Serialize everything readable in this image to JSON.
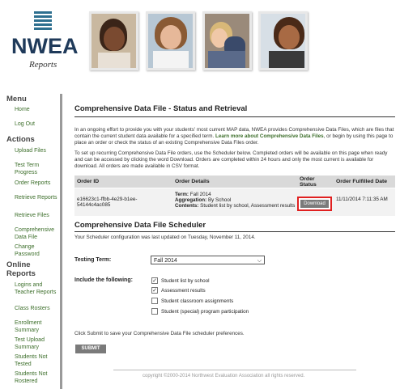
{
  "brand": {
    "name": "NWEA",
    "sub": "Reports"
  },
  "sidebar": {
    "menu_heading": "Menu",
    "menu_items": [
      "Home",
      "Log Out"
    ],
    "actions_heading": "Actions",
    "actions_items": [
      "Upload Files",
      "Test Term Progress",
      "Order Reports",
      "Retrieve Reports",
      "Retrieve Files",
      "Comprehensive Data File",
      "Change Password"
    ],
    "online_heading": "Online Reports",
    "online_items": [
      "Logins and Teacher Reports",
      "Class Rosters",
      "Enrollment Summary",
      "Test Upload Summary",
      "Students Not Tested",
      "Students Not Rostered"
    ]
  },
  "main": {
    "title": "Comprehensive Data File - Status and Retrieval",
    "intro": "In an ongoing effort to provide you with your students' most current MAP data, NWEA provides Comprehensive Data Files, which are files that contain the current student data available for a specified term.",
    "intro_link": "Learn more about Comprehensive Data Files",
    "intro_tail": ", or begin by using this page to place an order or check the status of an existing Comprehensive Data Files order.",
    "setup": "To set up recurring Comprehensive Data File orders, use the Scheduler below. Completed orders will be available on this page when ready and can be accessed by clicking the word Download. Orders are completed within 24 hours and only the most current is available for download. All orders are made available in CSV format."
  },
  "table": {
    "headers": {
      "order_id": "Order ID",
      "details": "Order Details",
      "status": "Order Status",
      "fulfilled": "Order Fulfilled Date"
    },
    "row": {
      "order_id": "e16623c1-ffbb-4e29-b1ee-54144c4ac085",
      "term_label": "Term:",
      "term": "Fall 2014",
      "agg_label": "Aggregation:",
      "agg": "By School",
      "contents_label": "Contents:",
      "contents": "Student list by school, Assessment results",
      "download": "Download",
      "fulfilled": "11/11/2014 7:11:35 AM"
    }
  },
  "scheduler": {
    "title": "Comprehensive Data File Scheduler",
    "updated": "Your Scheduler configuration was last updated on Tuesday, November 11, 2014.",
    "term_label": "Testing Term:",
    "term_value": "Fall 2014",
    "include_label": "Include the following:",
    "options": [
      {
        "label": "Student list by school",
        "checked": "✓"
      },
      {
        "label": "Assessment results",
        "checked": "✓"
      },
      {
        "label": "Student classroom assignments",
        "checked": ""
      },
      {
        "label": "Student (special) program participation",
        "checked": ""
      }
    ],
    "submit_note": "Click Submit to save your Comprehensive Data File scheduler preferences.",
    "submit": "SUBMIT"
  },
  "footer": "copyright ©2000-2014 Northwest Evaluation Association all rights reserved."
}
